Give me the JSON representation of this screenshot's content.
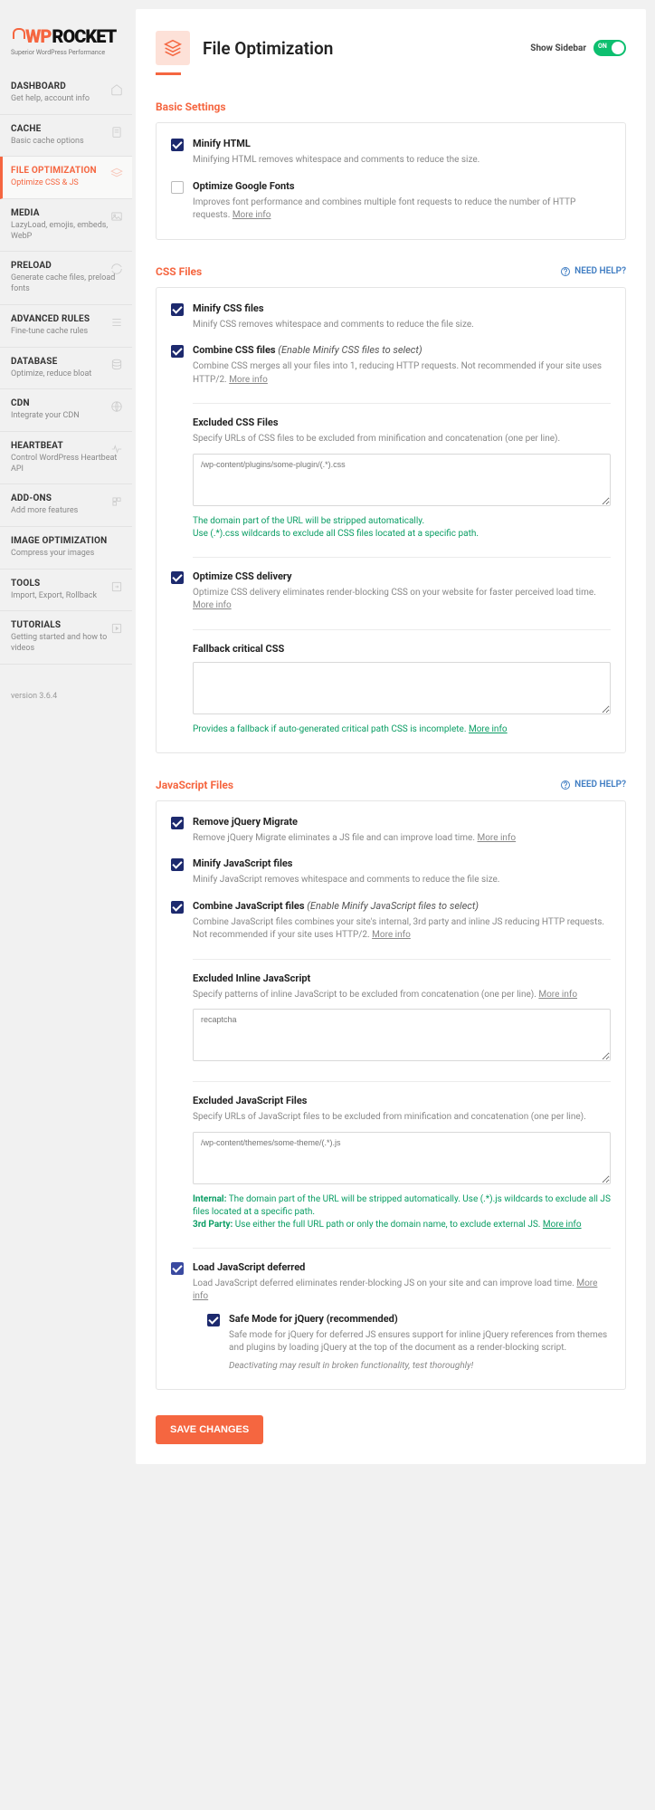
{
  "logo": {
    "brand1": "WP",
    "brand2": "ROCKET",
    "tagline": "Superior WordPress Performance"
  },
  "nav": [
    {
      "title": "DASHBOARD",
      "sub": "Get help, account info"
    },
    {
      "title": "CACHE",
      "sub": "Basic cache options"
    },
    {
      "title": "FILE OPTIMIZATION",
      "sub": "Optimize CSS & JS"
    },
    {
      "title": "MEDIA",
      "sub": "LazyLoad, emojis, embeds, WebP"
    },
    {
      "title": "PRELOAD",
      "sub": "Generate cache files, preload fonts"
    },
    {
      "title": "ADVANCED RULES",
      "sub": "Fine-tune cache rules"
    },
    {
      "title": "DATABASE",
      "sub": "Optimize, reduce bloat"
    },
    {
      "title": "CDN",
      "sub": "Integrate your CDN"
    },
    {
      "title": "HEARTBEAT",
      "sub": "Control WordPress Heartbeat API"
    },
    {
      "title": "ADD-ONS",
      "sub": "Add more features"
    },
    {
      "title": "IMAGE OPTIMIZATION",
      "sub": "Compress your images"
    },
    {
      "title": "TOOLS",
      "sub": "Import, Export, Rollback"
    },
    {
      "title": "TUTORIALS",
      "sub": "Getting started and how to videos"
    }
  ],
  "version": "version 3.6.4",
  "header": {
    "title": "File Optimization",
    "show_sidebar": "Show Sidebar",
    "toggle": "ON"
  },
  "need_help": "NEED HELP?",
  "more_info": "More info",
  "sections": {
    "basic": {
      "title": "Basic Settings",
      "minify_html": {
        "label": "Minify HTML",
        "desc": "Minifying HTML removes whitespace and comments to reduce the size."
      },
      "google_fonts": {
        "label": "Optimize Google Fonts",
        "desc": "Improves font performance and combines multiple font requests to reduce the number of HTTP requests."
      }
    },
    "css": {
      "title": "CSS Files",
      "minify": {
        "label": "Minify CSS files",
        "desc": "Minify CSS removes whitespace and comments to reduce the file size."
      },
      "combine": {
        "label": "Combine CSS files",
        "note": "(Enable Minify CSS files to select)",
        "desc": "Combine CSS merges all your files into 1, reducing HTTP requests. Not recommended if your site uses HTTP/2."
      },
      "excluded": {
        "label": "Excluded CSS Files",
        "desc": "Specify URLs of CSS files to be excluded from minification and concatenation (one per line).",
        "placeholder": "/wp-content/plugins/some-plugin/(.*).css",
        "hint1": "The domain part of the URL will be stripped automatically.",
        "hint2": "Use (.*).css wildcards to exclude all CSS files located at a specific path."
      },
      "optimize": {
        "label": "Optimize CSS delivery",
        "desc": "Optimize CSS delivery eliminates render-blocking CSS on your website for faster perceived load time."
      },
      "fallback": {
        "label": "Fallback critical CSS",
        "hint": "Provides a fallback if auto-generated critical path CSS is incomplete."
      }
    },
    "js": {
      "title": "JavaScript Files",
      "jquery_migrate": {
        "label": "Remove jQuery Migrate",
        "desc": "Remove jQuery Migrate eliminates a JS file and can improve load time."
      },
      "minify": {
        "label": "Minify JavaScript files",
        "desc": "Minify JavaScript removes whitespace and comments to reduce the file size."
      },
      "combine": {
        "label": "Combine JavaScript files",
        "note": "(Enable Minify JavaScript files to select)",
        "desc": "Combine JavaScript files combines your site's internal, 3rd party and inline JS reducing HTTP requests. Not recommended if your site uses HTTP/2."
      },
      "excl_inline": {
        "label": "Excluded Inline JavaScript",
        "desc": "Specify patterns of inline JavaScript to be excluded from concatenation (one per line).",
        "placeholder": "recaptcha"
      },
      "excl_files": {
        "label": "Excluded JavaScript Files",
        "desc": "Specify URLs of JavaScript files to be excluded from minification and concatenation (one per line).",
        "placeholder": "/wp-content/themes/some-theme/(.*).js",
        "hint_internal_lbl": "Internal:",
        "hint_internal": " The domain part of the URL will be stripped automatically. Use (.*).js wildcards to exclude all JS files located at a specific path.",
        "hint_3p_lbl": "3rd Party:",
        "hint_3p": " Use either the full URL path or only the domain name, to exclude external JS."
      },
      "deferred": {
        "label": "Load JavaScript deferred",
        "desc": "Load JavaScript deferred eliminates render-blocking JS on your site and can improve load time."
      },
      "safemode": {
        "label": "Safe Mode for jQuery (recommended)",
        "desc": "Safe mode for jQuery for deferred JS ensures support for inline jQuery references from themes and plugins by loading jQuery at the top of the document as a render-blocking script.",
        "warn": "Deactivating may result in broken functionality, test thoroughly!"
      }
    }
  },
  "save": "SAVE CHANGES"
}
